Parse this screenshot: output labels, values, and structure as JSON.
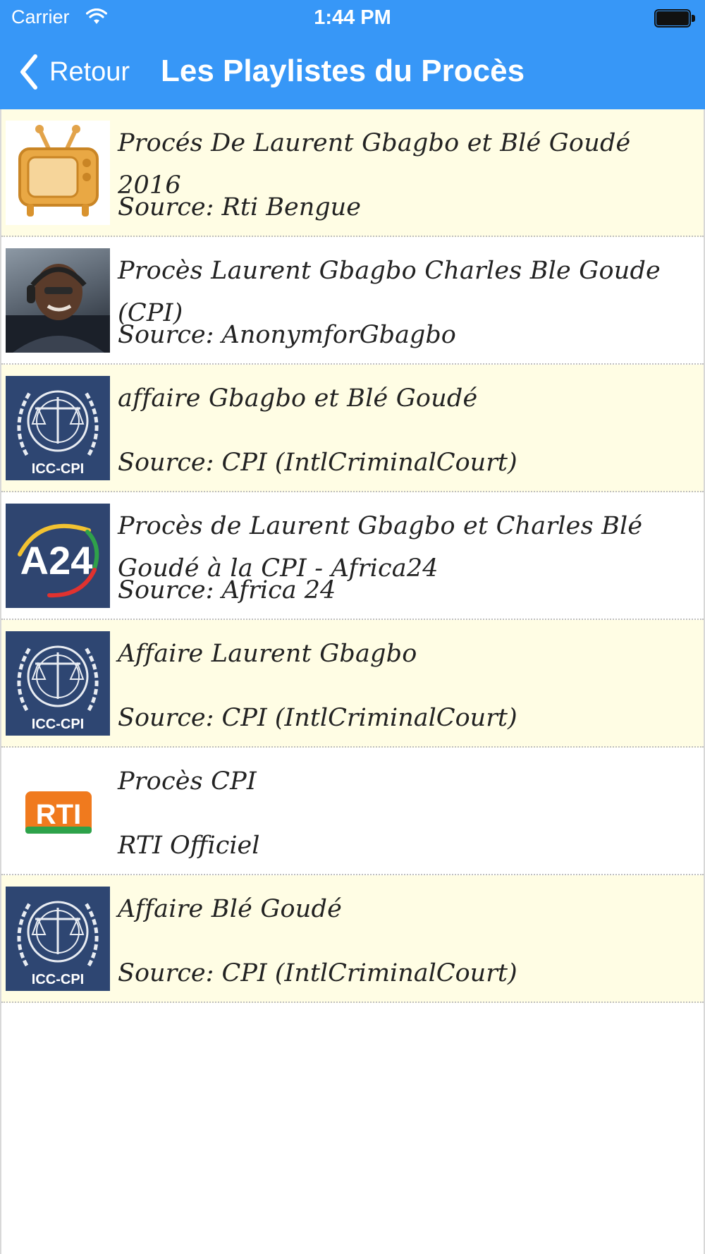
{
  "status_bar": {
    "carrier": "Carrier",
    "time": "1:44 PM"
  },
  "nav": {
    "back_label": "Retour",
    "title": "Les Playlistes du Procès"
  },
  "playlists": [
    {
      "title": "Procés De Laurent Gbagbo et Blé Goudé 2016",
      "subtitle": "Source: Rti Bengue",
      "thumbnail": "tv-icon"
    },
    {
      "title": "Procès Laurent Gbagbo  Charles Ble Goude (CPI)",
      "subtitle": "Source: AnonymforGbagbo",
      "thumbnail": "photo"
    },
    {
      "title": "affaire Gbagbo et Blé Goudé",
      "subtitle": "Source: CPI (IntlCriminalCourt)",
      "thumbnail": "icc-cpi-logo",
      "logo_text": "ICC-CPI"
    },
    {
      "title": "Procès de Laurent Gbagbo et Charles Blé Goudé à la CPI - Africa24",
      "subtitle": "Source: Africa 24",
      "thumbnail": "africa24-logo",
      "logo_text": "A24"
    },
    {
      "title": "Affaire Laurent Gbagbo",
      "subtitle": "Source: CPI (IntlCriminalCourt)",
      "thumbnail": "icc-cpi-logo",
      "logo_text": "ICC-CPI"
    },
    {
      "title": "Procès CPI",
      "subtitle": "RTI Officiel",
      "thumbnail": "rti-logo",
      "logo_text": "RTI"
    },
    {
      "title": "Affaire Blé Goudé",
      "subtitle": "Source: CPI (IntlCriminalCourt)",
      "thumbnail": "icc-cpi-logo",
      "logo_text": "ICC-CPI"
    }
  ],
  "colors": {
    "nav_blue": "#3797F7",
    "row_alt": "#FFFDE4",
    "icc_blue": "#2E4672"
  }
}
